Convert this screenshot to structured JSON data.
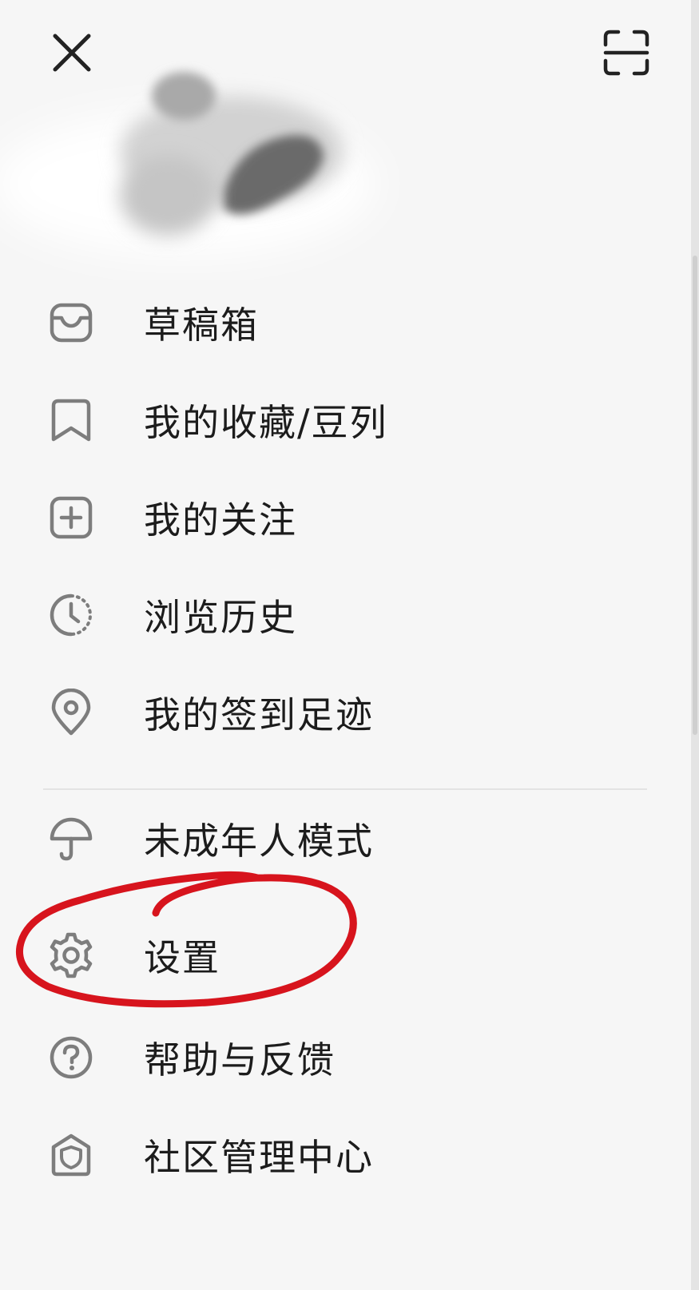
{
  "header": {
    "close_icon": "close-icon",
    "scan_icon": "scan-icon"
  },
  "menu": {
    "items": [
      {
        "label": "草稿箱",
        "icon": "drafts-inbox-icon"
      },
      {
        "label": "我的收藏/豆列",
        "icon": "bookmark-icon"
      },
      {
        "label": "我的关注",
        "icon": "plus-square-icon"
      },
      {
        "label": "浏览历史",
        "icon": "history-clock-icon"
      },
      {
        "label": "我的签到足迹",
        "icon": "location-pin-icon"
      },
      {
        "label": "未成年人模式",
        "icon": "umbrella-icon"
      },
      {
        "label": "设置",
        "icon": "gear-icon"
      },
      {
        "label": "帮助与反馈",
        "icon": "help-icon"
      },
      {
        "label": "社区管理中心",
        "icon": "shield-icon"
      }
    ]
  },
  "annotation": {
    "color": "#d7141d"
  },
  "colors": {
    "background": "#f6f6f6",
    "text": "#1c1c1c",
    "icon": "#7d7d7d"
  }
}
